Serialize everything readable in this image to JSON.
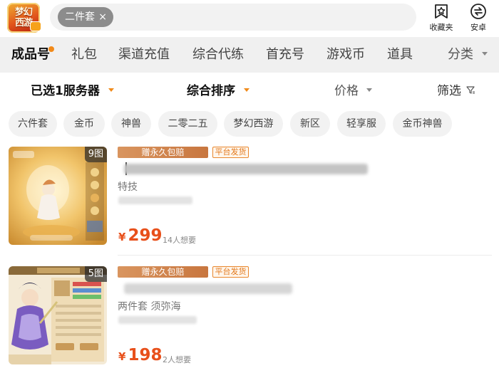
{
  "app": {
    "logo_line1": "梦幻",
    "logo_line2": "西游"
  },
  "search": {
    "chip_label": "二件套",
    "chip_close": "×"
  },
  "top_actions": {
    "favorites_label": "收藏夹",
    "platform_label": "安卓"
  },
  "categories": {
    "items": [
      {
        "label": "成品号"
      },
      {
        "label": "礼包"
      },
      {
        "label": "渠道充值"
      },
      {
        "label": "综合代练"
      },
      {
        "label": "首充号"
      },
      {
        "label": "游戏币"
      },
      {
        "label": "道具"
      }
    ],
    "more_label": "分类"
  },
  "filters": {
    "server_label": "已选1服务器",
    "sort_label": "综合排序",
    "price_label": "价格",
    "filter_label": "筛选"
  },
  "tags": [
    {
      "label": "六件套"
    },
    {
      "label": "金币"
    },
    {
      "label": "神兽"
    },
    {
      "label": "二零二五"
    },
    {
      "label": "梦幻西游"
    },
    {
      "label": "新区"
    },
    {
      "label": "轻享服"
    },
    {
      "label": "金币神兽"
    }
  ],
  "listings": [
    {
      "image_count": "9图",
      "gift_badge": "赠永久包赔",
      "platform_badge": "平台发货",
      "subtitle": "特技",
      "price_symbol": "¥",
      "price": "299",
      "wants": "14人想要"
    },
    {
      "image_count": "5图",
      "gift_badge": "赠永久包赔",
      "platform_badge": "平台发货",
      "subtitle": "两件套 须弥海",
      "price_symbol": "¥",
      "price": "198",
      "wants": "2人想要"
    }
  ],
  "colors": {
    "accent": "#f08a1a",
    "price": "#e8501b",
    "badge_gift": "#d08850"
  },
  "icons": {
    "favorites": "star-box-icon",
    "platform": "android-switch-icon",
    "chip_close": "close-icon",
    "filter": "funnel-icon"
  }
}
